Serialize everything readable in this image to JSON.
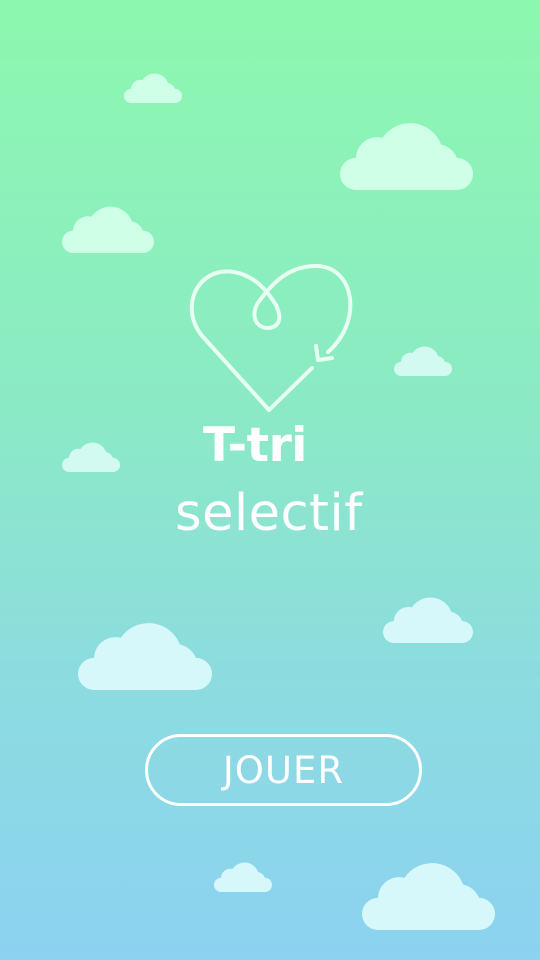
{
  "screen": "title-screen",
  "background": {
    "gradient_top": "#8CF8AE",
    "gradient_bottom": "#8CD2F1"
  },
  "cloud_colors": [
    "#CFFFE7",
    "#D6F8FB"
  ],
  "logo": {
    "icon": "heart-recycle-icon",
    "title_line_1": "T-tri",
    "title_line_2": "selectif",
    "color": "#FFFFFF"
  },
  "play_button": {
    "label": "JOUER",
    "border_color": "#FFFFFF"
  }
}
